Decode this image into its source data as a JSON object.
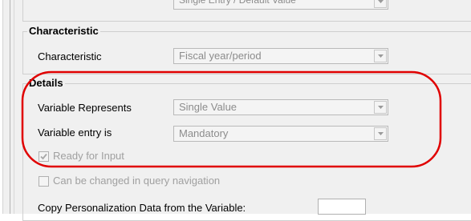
{
  "top_partial": {
    "value": "Single Entry / Default Value"
  },
  "characteristic_group": {
    "title": "Characteristic",
    "label": "Characteristic",
    "value": "Fiscal year/period"
  },
  "details_group": {
    "title": "Details",
    "variable_represents_label": "Variable Represents",
    "variable_represents_value": "Single Value",
    "variable_entry_label": "Variable entry is",
    "variable_entry_value": "Mandatory",
    "ready_for_input_label": "Ready for Input",
    "ready_for_input_checked": true,
    "can_be_changed_label": "Can be changed in query navigation",
    "can_be_changed_checked": false,
    "copy_personalization_label": "Copy Personalization Data from the Variable:",
    "copy_personalization_value": ""
  },
  "annotation": {
    "highlight_color": "#e00000"
  }
}
